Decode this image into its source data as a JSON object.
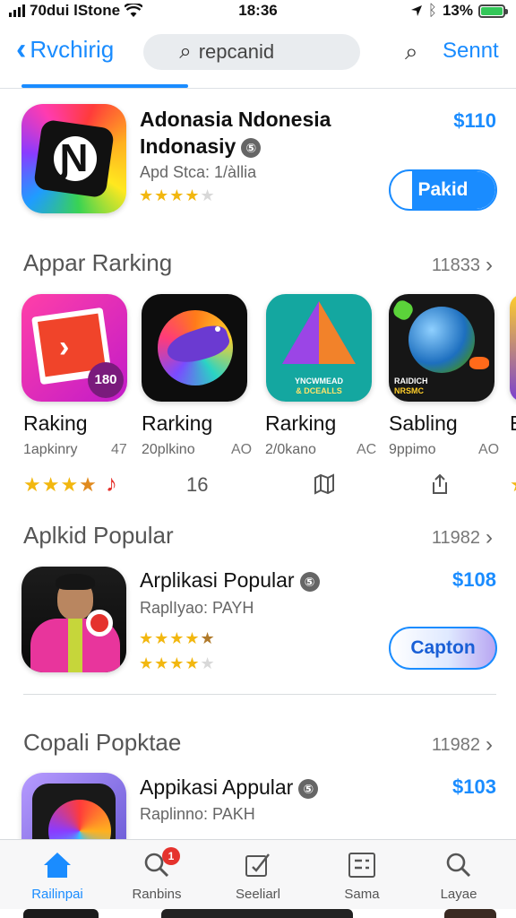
{
  "status_bar": {
    "carrier": "70dui lStone",
    "time": "18:36",
    "battery": "13%"
  },
  "nav": {
    "back_label": "Rvchirig",
    "search_value": "repcanid",
    "action_label": "Sennt"
  },
  "featured": {
    "title_line1": "Adonasia Ndonesia",
    "title_line2": "Indonasiy",
    "subtitle": "Apd Stca: 1/àllia",
    "price": "$110",
    "button_label": "Pakid",
    "rating": 4,
    "icon_text": "Ɲ"
  },
  "ranking": {
    "header": "Appar Rarking",
    "count": "11833",
    "items": [
      {
        "name": "Raking",
        "sub": "1apkinry",
        "num": "47",
        "icon_text": "180"
      },
      {
        "name": "Rarking",
        "sub": "20plkino",
        "num": "AO"
      },
      {
        "name": "Rarking",
        "sub": "2/0kano",
        "num": "AC",
        "icon_text1": "YNCWMEAD",
        "icon_text2": "& DCEALLS"
      },
      {
        "name": "Sabling",
        "sub": "9ppimo",
        "num": "AO",
        "icon_text1": "RAIDICH",
        "icon_text2": "NRSMC"
      },
      {
        "name": "E",
        "sub": "",
        "num": ""
      }
    ],
    "row3_middle": "16"
  },
  "popular": {
    "header": "Aplkid Popular",
    "count": "11982",
    "title": "Arplikasi Popular",
    "subtitle": "RaplIyao: PAYH",
    "price": "$108",
    "button_label": "Capton"
  },
  "popular2": {
    "header": "Copali Popktae",
    "count": "11982",
    "title": "Appikasi Appular",
    "subtitle": "Raplinno: PAKH",
    "price": "$103"
  },
  "tabs": [
    {
      "label": "Railinpai",
      "icon": "house-icon",
      "active": true
    },
    {
      "label": "Ranbins",
      "icon": "search-icon",
      "badge": "1"
    },
    {
      "label": "Seeliarl",
      "icon": "edit-icon"
    },
    {
      "label": "Sama",
      "icon": "list-icon"
    },
    {
      "label": "Layae",
      "icon": "search-icon"
    }
  ],
  "colors": {
    "accent": "#1a8cff",
    "star": "#f2b70f",
    "badge": "#e5322d",
    "battery": "#34c759"
  }
}
